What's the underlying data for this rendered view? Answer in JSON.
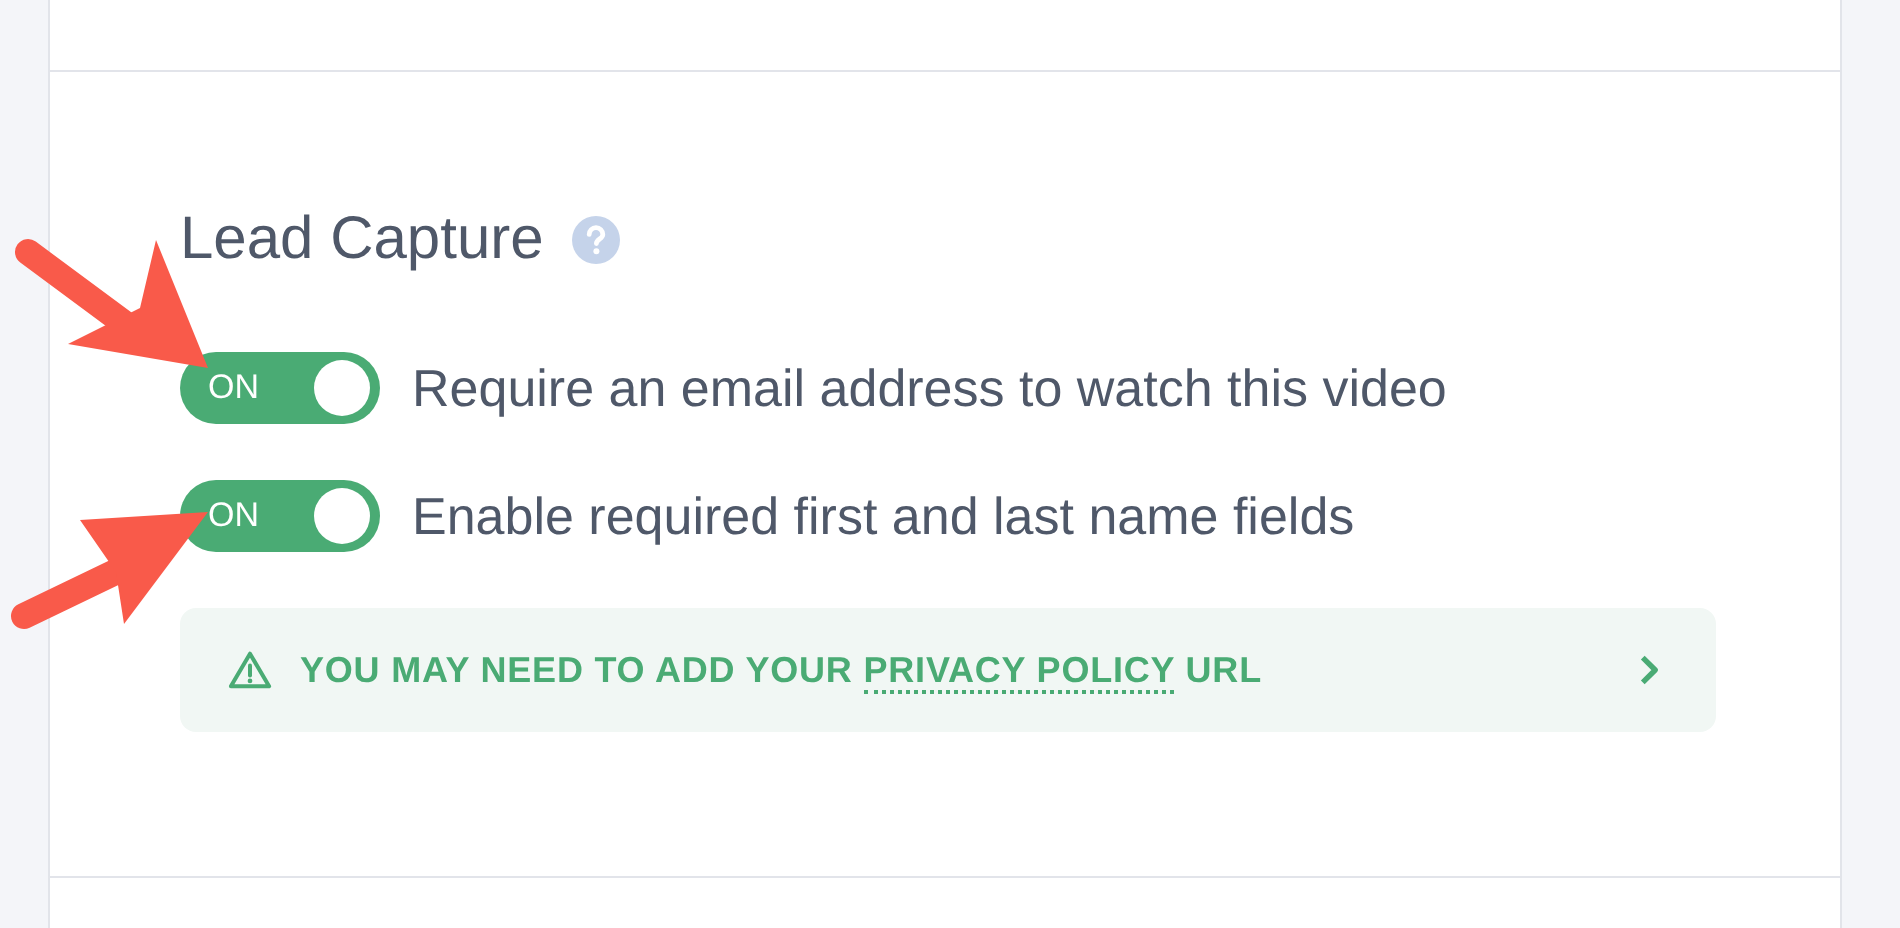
{
  "section": {
    "title": "Lead Capture"
  },
  "options": [
    {
      "toggle_label": "ON",
      "on": true,
      "label": "Require an email address to watch this video"
    },
    {
      "toggle_label": "ON",
      "on": true,
      "label": "Enable required first and last name fields"
    }
  ],
  "notice": {
    "prefix": "YOU MAY NEED TO ADD YOUR ",
    "link": "PRIVACY POLICY",
    "suffix": " URL"
  }
}
